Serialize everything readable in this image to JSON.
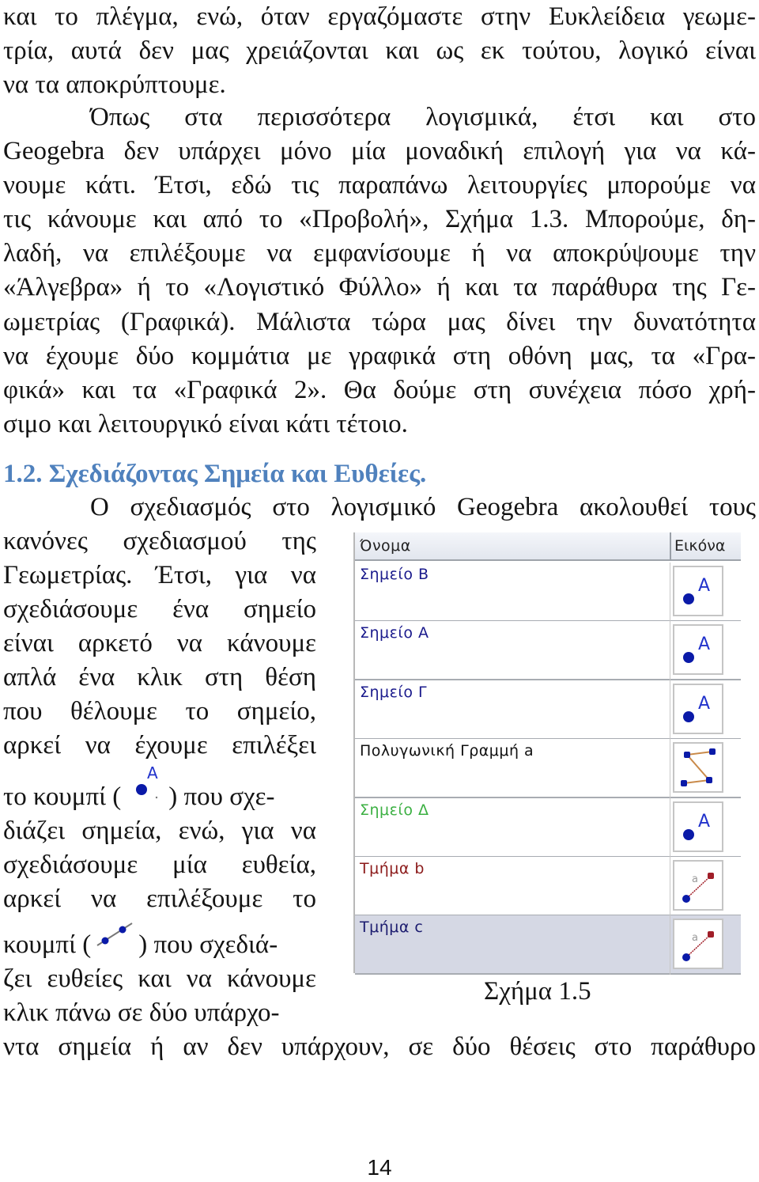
{
  "paragraph1": {
    "lines": [
      "και το πλέγμα, ενώ, όταν εργαζόμαστε στην Ευκλείδεια γεωμε-",
      "τρία, αυτά δεν μας χρειάζονται και ως εκ τούτου, λογικό είναι",
      "να τα αποκρύπτουμε."
    ]
  },
  "paragraph2": {
    "lines": [
      "Όπως στα περισσότερα λογισμικά, έτσι και στο",
      "Geogebra δεν υπάρχει μόνο μία μοναδική επιλογή για να κά-",
      "νουμε κάτι. Έτσι, εδώ τις παραπάνω λειτουργίες μπορούμε να",
      "τις κάνουμε και από το «Προβολή», Σχήμα 1.3. Μπορούμε, δη-",
      "λαδή, να επιλέξουμε να εμφανίσουμε ή να αποκρύψουμε την",
      "«Άλγεβρα» ή το «Λογιστικό Φύλλο» ή και τα παράθυρα της Γε-",
      "ωμετρίας (Γραφικά). Μάλιστα τώρα μας δίνει την δυνατότητα",
      "να έχουμε δύο κομμάτια με γραφικά στη οθόνη μας, τα «Γρα-",
      "φικά» και τα «Γραφικά 2». Θα δούμε στη συνέχεια πόσο χρή-",
      "σιμο και λειτουργικό είναι κάτι τέτοιο."
    ]
  },
  "section_heading": "1.2. Σχεδιάζοντας Σημεία και Ευθείες.",
  "paragraph3": {
    "first_line": "Ο σχεδιασμός στο λογισμικό Geogebra ακολουθεί τους",
    "left_lines": [
      "κανόνες σχεδιασμού της",
      "Γεωμετρίας. Έτσι, για να",
      "σχεδιάσουμε ένα σημείο",
      "είναι αρκετό να κάνουμε",
      "απλά ένα κλικ στη θέση",
      "που θέλουμε το σημείο,",
      "αρκεί να έχουμε επιλέξει"
    ],
    "point_button_line": {
      "before": "το κουμπί (",
      "after": ") που σχε-"
    },
    "middle_lines": [
      "διάζει σημεία, ενώ, για να",
      "σχεδιάσουμε μία ευθεία,",
      "αρκεί να επιλέξουμε το"
    ],
    "line_button_line": {
      "before": "κουμπί (",
      "after": ") που σχεδιά-"
    },
    "end_lines": [
      "ζει ευθείες και να κάνουμε",
      "κλικ πάνω σε δύο υπάρχο-"
    ],
    "last_line": "ντα σημεία ή αν δεν υπάρχουν, σε δύο θέσεις στο παράθυρο"
  },
  "figure": {
    "caption": "Σχήμα 1.5",
    "table": {
      "columns": [
        "Όνομα",
        "Εικόνα"
      ],
      "rows": [
        {
          "name": "Σημείο B",
          "color": "#1a1a8c",
          "icon": "point-tool-icon"
        },
        {
          "name": "Σημείο A",
          "color": "#1a1a8c",
          "icon": "point-tool-icon"
        },
        {
          "name": "Σημείο Γ",
          "color": "#1a1a8c",
          "icon": "point-tool-icon"
        },
        {
          "name": "Πολυγωνική Γραμμή a",
          "color": "#111111",
          "icon": "polyline-tool-icon"
        },
        {
          "name": "Σημείο Δ",
          "color": "#3cb043",
          "icon": "point-tool-icon"
        },
        {
          "name": "Τμήμα b",
          "color": "#8b1a1a",
          "icon": "segment-tool-icon"
        },
        {
          "name": "Τμήμα c",
          "color": "#1a1a6e",
          "icon": "segment-tool-icon",
          "selected": true
        }
      ]
    }
  },
  "page_number": "14",
  "colors": {
    "heading": "#4f81bd",
    "point_blue": "#0a1aa8",
    "segment_red": "#a01e28"
  }
}
